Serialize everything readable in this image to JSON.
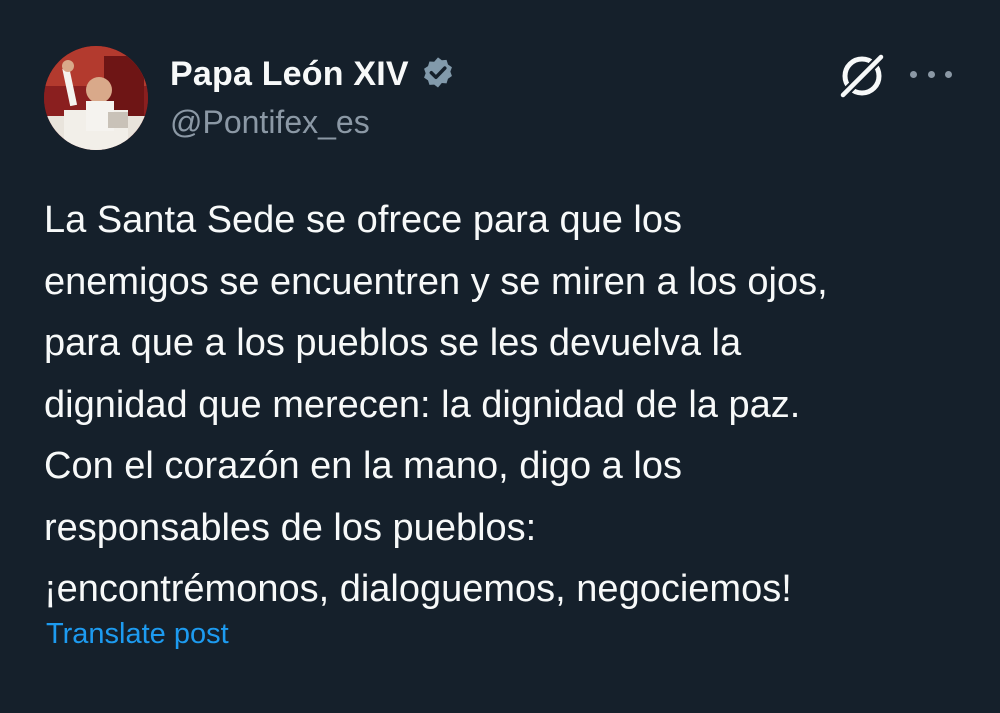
{
  "author": {
    "display_name": "Papa León XIV",
    "handle": "@Pontifex_es",
    "verified": true,
    "avatar_icon": "pope-avatar"
  },
  "actions": {
    "grok_icon": "grok-icon",
    "more_icon": "more-options-icon"
  },
  "post": {
    "lines": [
      "La Santa Sede se ofrece para que los",
      "enemigos se encuentren y se miren a los ojos,",
      "para que a los pueblos se les devuelva la",
      "dignidad que merecen: la dignidad de la paz.",
      "Con el corazón en la mano, digo a los",
      "responsables de los pueblos:",
      "¡encontrémonos, dialoguemos, negociemos!"
    ]
  },
  "translate_label": "Translate post",
  "colors": {
    "background": "#15202b",
    "text": "#f7f9f9",
    "secondary": "#8b98a5",
    "link": "#1d9bf0",
    "verified_badge": "#829aab"
  }
}
